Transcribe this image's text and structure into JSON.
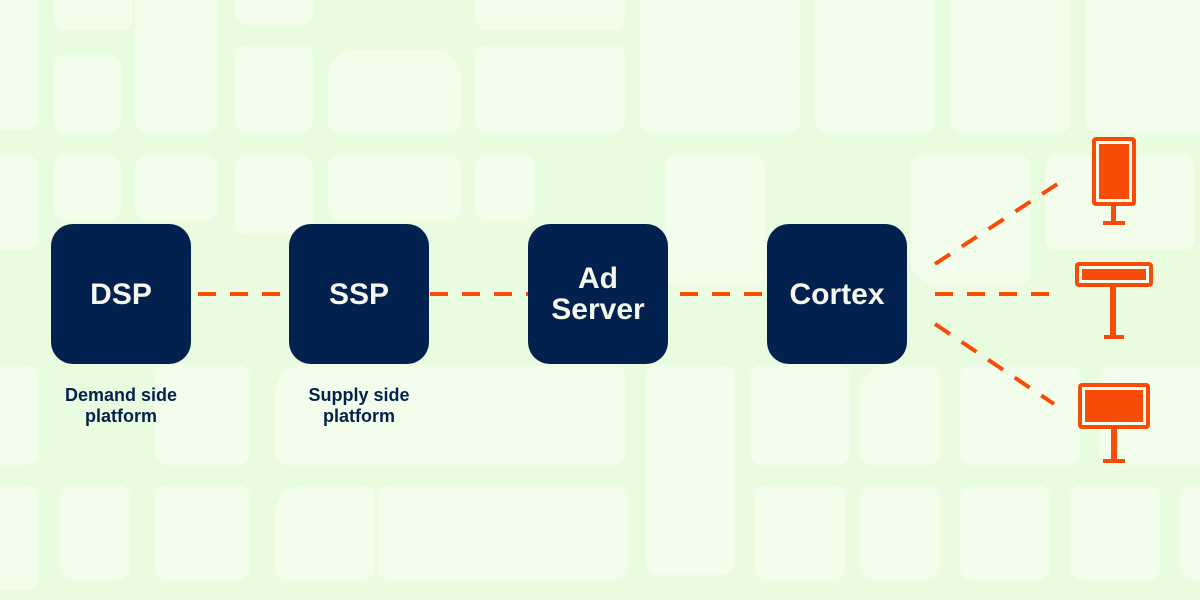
{
  "colors": {
    "background": "#eafcdf",
    "node_fill": "#03214f",
    "node_text": "#f4f8ee",
    "accent": "#f84b08"
  },
  "nodes": [
    {
      "id": "dsp",
      "label": "DSP",
      "caption": "Demand side\nplatform"
    },
    {
      "id": "ssp",
      "label": "SSP",
      "caption": "Supply side\nplatform"
    },
    {
      "id": "ad-server",
      "label": "Ad\nServer",
      "caption": ""
    },
    {
      "id": "cortex",
      "label": "Cortex",
      "caption": ""
    }
  ],
  "edges": [
    {
      "from": "dsp",
      "to": "ssp",
      "style": "dashed"
    },
    {
      "from": "ssp",
      "to": "ad-server",
      "style": "dashed"
    },
    {
      "from": "ad-server",
      "to": "cortex",
      "style": "dashed"
    },
    {
      "from": "cortex",
      "to": "screen-portrait",
      "style": "dashed"
    },
    {
      "from": "cortex",
      "to": "screen-banner",
      "style": "dashed"
    },
    {
      "from": "cortex",
      "to": "screen-landscape",
      "style": "dashed"
    }
  ],
  "endpoints": [
    {
      "id": "screen-portrait",
      "icon": "portrait-display-icon"
    },
    {
      "id": "screen-banner",
      "icon": "banner-billboard-icon"
    },
    {
      "id": "screen-landscape",
      "icon": "landscape-billboard-icon"
    }
  ]
}
